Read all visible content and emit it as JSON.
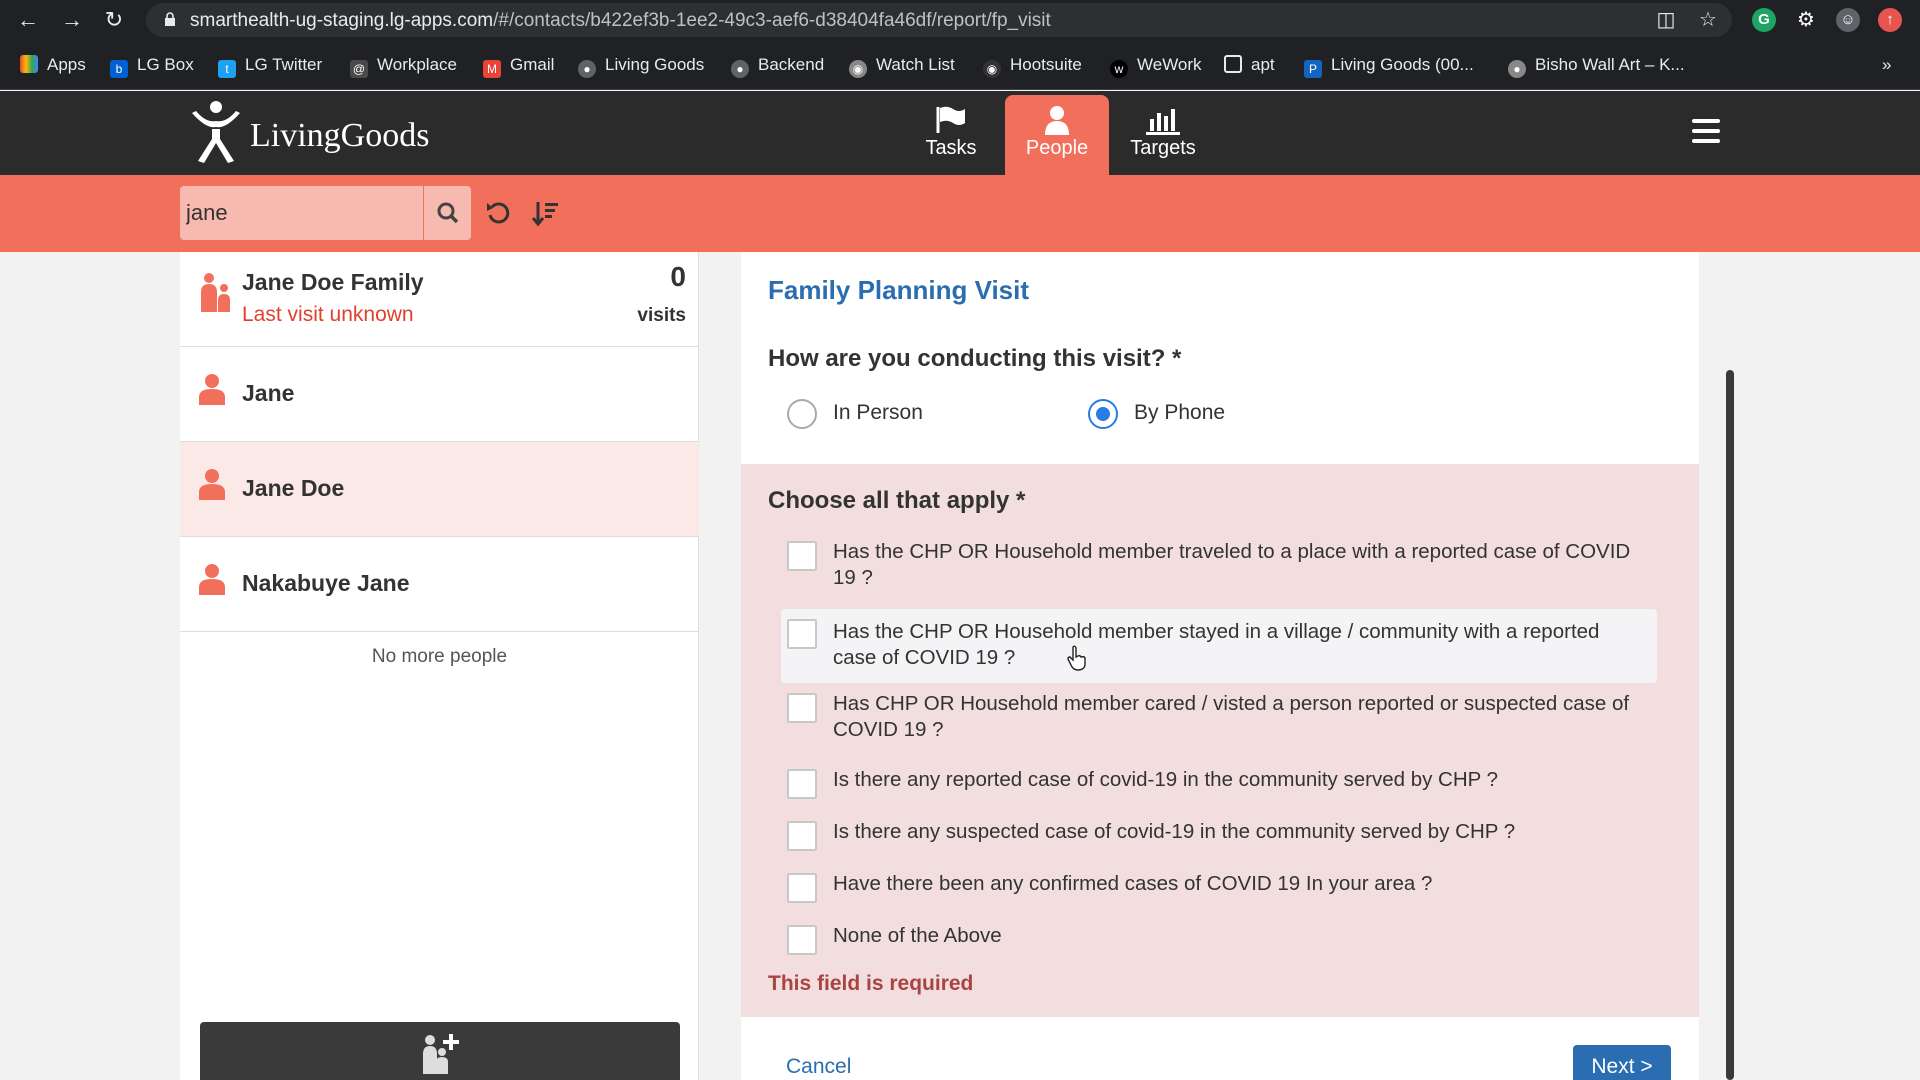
{
  "browser": {
    "url_host": "smarthealth-ug-staging.lg-apps.com",
    "url_path": "/#/contacts/b422ef3b-1ee2-49c3-aef6-d38404fa46df/report/fp_visit",
    "bookmarks": [
      "Apps",
      "LG Box",
      "LG Twitter",
      "Workplace",
      "Gmail",
      "Living Goods",
      "Backend",
      "Watch List",
      "Hootsuite",
      "WeWork",
      "apt",
      "Living Goods (00...",
      "Bisho Wall Art – K..."
    ],
    "bookmark_overflow": "»"
  },
  "header": {
    "logo": "LivingGoods",
    "tabs": [
      {
        "label": "Tasks"
      },
      {
        "label": "People"
      },
      {
        "label": "Targets"
      }
    ]
  },
  "search": {
    "value": "jane"
  },
  "people": {
    "family": {
      "name": "Jane Doe Family",
      "last_visit": "Last visit unknown",
      "visits_count": "0",
      "visits_label": "visits"
    },
    "persons": [
      "Jane",
      "Jane Doe",
      "Nakabuye Jane"
    ],
    "no_more": "No more people"
  },
  "form": {
    "title": "Family Planning Visit",
    "q1": "How are you conducting this visit? *",
    "q1_options": [
      "In Person",
      "By Phone"
    ],
    "q1_selected": "By Phone",
    "q2": "Choose all that apply *",
    "q2_options": [
      "Has the CHP OR Household member traveled to a place with a reported case of COVID 19 ?",
      "Has the CHP OR Household member stayed in a village / community with a reported case of COVID 19 ?",
      "Has CHP OR Household member cared / visted a person reported or suspected case of COVID 19 ?",
      "Is there any reported case of covid-19 in the community served by CHP ?",
      "Is there any suspected case of covid-19 in the community served by CHP ?",
      "Have there been any confirmed cases of COVID 19 In your area ?",
      "None of the Above"
    ],
    "error": "This field is required",
    "cancel": "Cancel",
    "next": "Next >"
  },
  "colors": {
    "accent": "#f26f5c",
    "header": "#2b2b2b",
    "link": "#2a6db0",
    "error": "#a94442"
  }
}
